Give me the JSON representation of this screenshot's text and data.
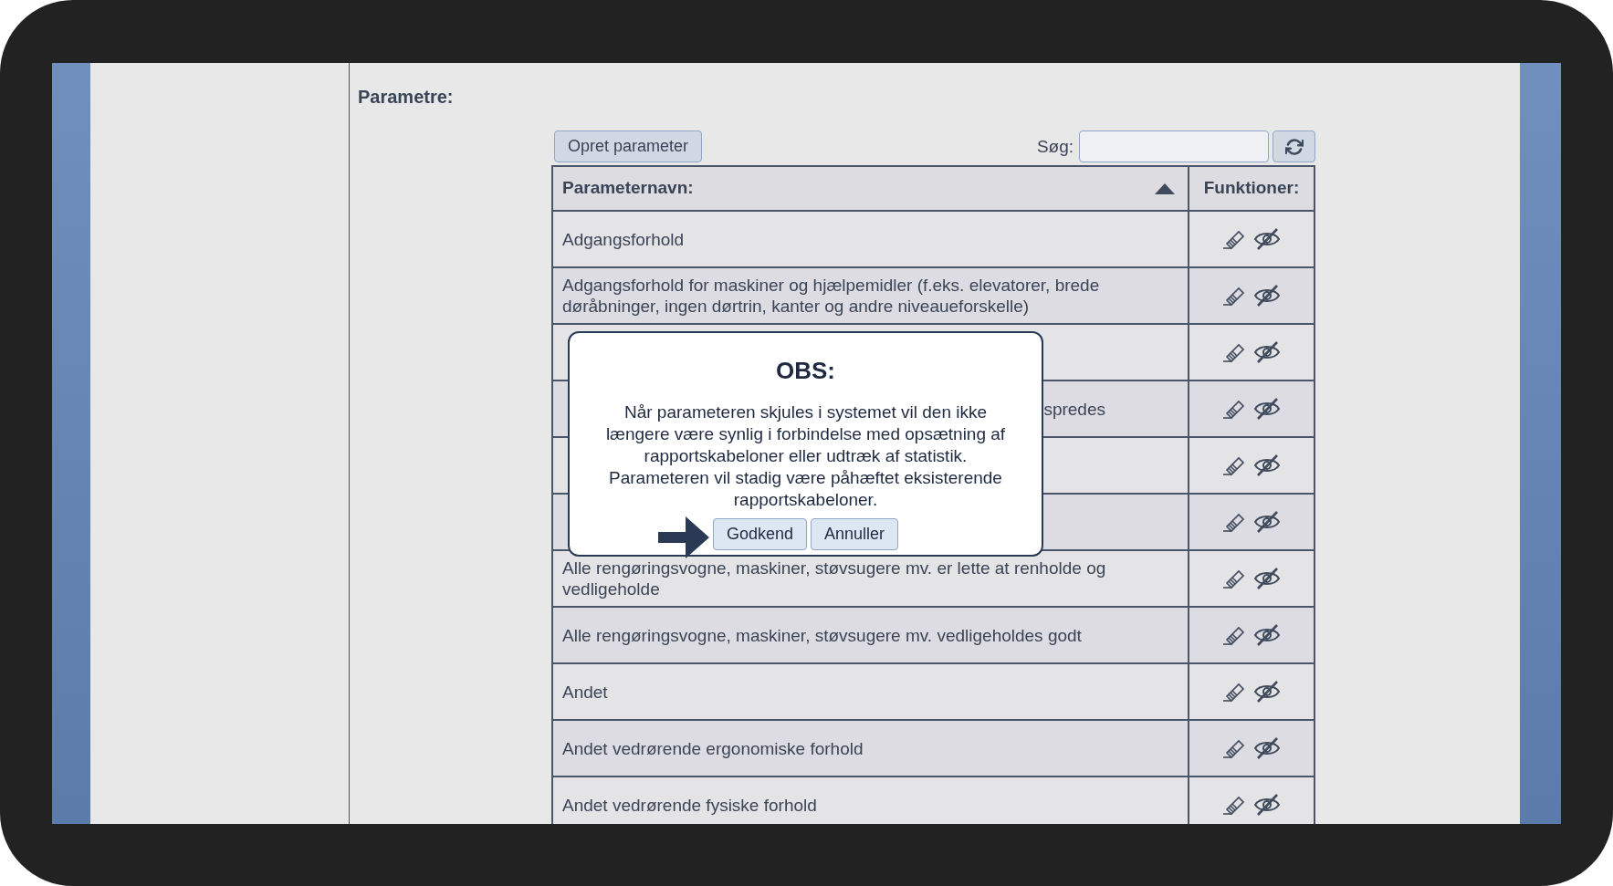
{
  "section_title": "Parametre:",
  "toolbar": {
    "create_button": "Opret parameter",
    "search_label": "Søg:"
  },
  "table": {
    "columns": [
      {
        "label": "Parameternavn:",
        "sort_ascending": true
      },
      {
        "label": "Funktioner:"
      }
    ],
    "rows": [
      {
        "kind": "plain",
        "name": "Adgangsforhold"
      },
      {
        "kind": "plain",
        "name": "Adgangsforhold for maskiner og hjælpemidler (f.eks. elevatorer, brede døråbninger, ingen dørtrin, kanter og andre niveaueforskelle)"
      },
      {
        "kind": "covered"
      },
      {
        "kind": "covered",
        "name_end": "spredes"
      },
      {
        "kind": "covered"
      },
      {
        "kind": "covered"
      },
      {
        "kind": "plain",
        "name": "Alle rengøringsvogne, maskiner, støvsugere mv. er lette at renholde og vedligeholde"
      },
      {
        "kind": "plain",
        "name": "Alle rengøringsvogne, maskiner, støvsugere mv. vedligeholdes godt"
      },
      {
        "kind": "plain",
        "name": "Andet"
      },
      {
        "kind": "plain",
        "name": "Andet vedrørende ergonomiske forhold"
      },
      {
        "kind": "plain",
        "name": "Andet vedrørende fysiske forhold"
      }
    ]
  },
  "dialog": {
    "title": "OBS:",
    "message": "Når parameteren skjules i systemet vil den ikke længere være synlig i forbindelse med opsætning af rapportskabeloner eller udtræk af statistik. Parameteren vil stadig være påhæftet eksisterende rapportskabeloner.",
    "buttons": [
      "Godkend",
      "Annuller"
    ]
  }
}
